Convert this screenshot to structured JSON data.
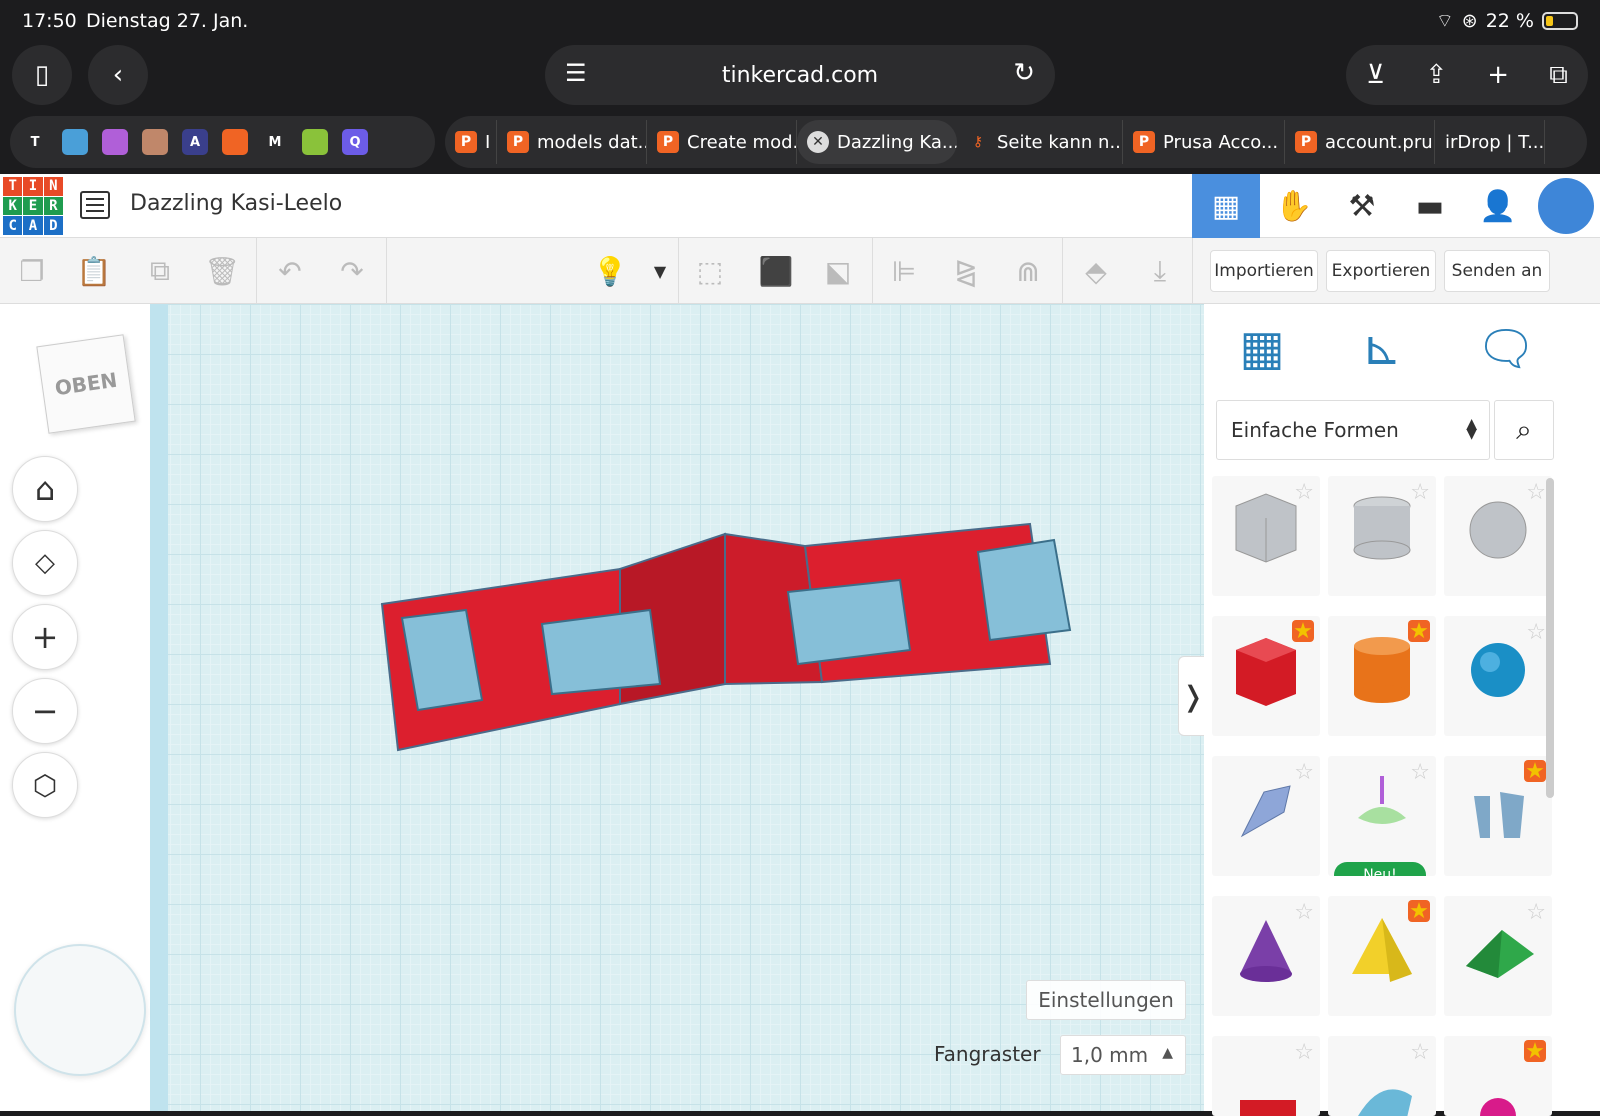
{
  "status": {
    "time": "17:50",
    "date": "Dienstag 27. Jan.",
    "battery": "22 %",
    "battery_level": 0.22
  },
  "browser": {
    "url": "tinkercad.com",
    "pinned_tabs": [
      {
        "letter": "T",
        "color": "#2c2c2e"
      },
      {
        "letter": "",
        "color": "#4a9fd8"
      },
      {
        "letter": "",
        "color": "#b05fd8"
      },
      {
        "letter": "",
        "color": "#c0876a"
      },
      {
        "letter": "A",
        "color": "#3a3f8c"
      },
      {
        "letter": "",
        "color": "#f06424"
      },
      {
        "letter": "M",
        "color": "#2c2c2e"
      },
      {
        "letter": "",
        "color": "#8ac23a"
      },
      {
        "letter": "Q",
        "color": "#6c5ce7"
      }
    ],
    "tabs": [
      {
        "label": "I",
        "icon": "P",
        "active": false
      },
      {
        "label": "models dat...",
        "icon": "P",
        "active": false
      },
      {
        "label": "Create mod...",
        "icon": "P",
        "active": false
      },
      {
        "label": "Dazzling Ka...",
        "icon": "x",
        "active": true
      },
      {
        "label": "Seite kann n...",
        "icon": "key",
        "active": false
      },
      {
        "label": "Prusa Acco...",
        "icon": "P",
        "active": false
      },
      {
        "label": "account.pru...",
        "icon": "P",
        "active": false
      },
      {
        "label": "irDrop | T...",
        "icon": "",
        "active": false
      }
    ]
  },
  "app": {
    "logo": [
      "T",
      "I",
      "N",
      "K",
      "E",
      "R",
      "C",
      "A",
      "D"
    ],
    "design_title": "Dazzling Kasi-Leelo",
    "buttons": {
      "import": "Importieren",
      "export": "Exportieren",
      "send": "Senden an"
    }
  },
  "viewport": {
    "viewcube_label": "OBEN",
    "settings": "Einstellungen",
    "snap_label": "Fangraster",
    "snap_value": "1,0 mm"
  },
  "panel": {
    "category": "Einfache Formen",
    "shapes": [
      {
        "name": "box-hole",
        "fav": false
      },
      {
        "name": "cylinder-hole",
        "fav": false
      },
      {
        "name": "sphere-hole",
        "fav": false
      },
      {
        "name": "box",
        "fav": true
      },
      {
        "name": "cylinder",
        "fav": true
      },
      {
        "name": "sphere",
        "fav": false
      },
      {
        "name": "scribble",
        "fav": false
      },
      {
        "name": "spinner",
        "fav": false,
        "badge": "Neu!"
      },
      {
        "name": "text-shape",
        "fav": true
      },
      {
        "name": "cone",
        "fav": false
      },
      {
        "name": "pyramid",
        "fav": true
      },
      {
        "name": "roof",
        "fav": false
      },
      {
        "name": "text",
        "fav": false
      },
      {
        "name": "half-sphere",
        "fav": false
      },
      {
        "name": "torus",
        "fav": true
      }
    ]
  }
}
